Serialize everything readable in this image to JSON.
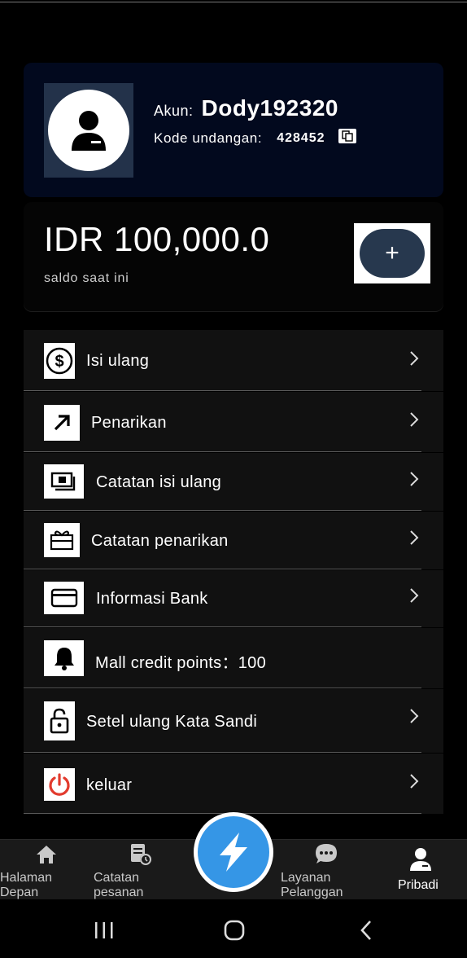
{
  "profile": {
    "account_label": "Akun:",
    "account_value": "Dody192320",
    "invite_label": "Kode undangan:",
    "invite_code": "428452"
  },
  "balance": {
    "amount": "IDR 100,000.0",
    "subtitle": "saldo saat ini",
    "topup_symbol": "+"
  },
  "menu": {
    "items": [
      {
        "label": "Isi ulang",
        "icon": "dollar-circle-icon"
      },
      {
        "label": "Penarikan",
        "icon": "arrow-up-right-icon"
      },
      {
        "label": "Catatan isi ulang",
        "icon": "cash-icon"
      },
      {
        "label": "Catatan penarikan",
        "icon": "gift-card-icon"
      },
      {
        "label": "Informasi Bank",
        "icon": "credit-card-icon"
      },
      {
        "label": "Mall credit points：100",
        "icon": "bell-icon"
      },
      {
        "label": "Setel ulang Kata Sandi",
        "icon": "lock-icon"
      },
      {
        "label": "keluar",
        "icon": "power-icon"
      }
    ]
  },
  "nav": {
    "home": "Halaman\nDepan",
    "orders": "Catatan\npesanan",
    "support": "Layanan\nPelanggan",
    "profile": "Pribadi"
  },
  "colors": {
    "profile_card_bg": "#02091e",
    "menu_bg": "#111111",
    "accent_blue": "#3596e6",
    "topup_btn": "#27384e",
    "power_red": "#e23b2e"
  }
}
